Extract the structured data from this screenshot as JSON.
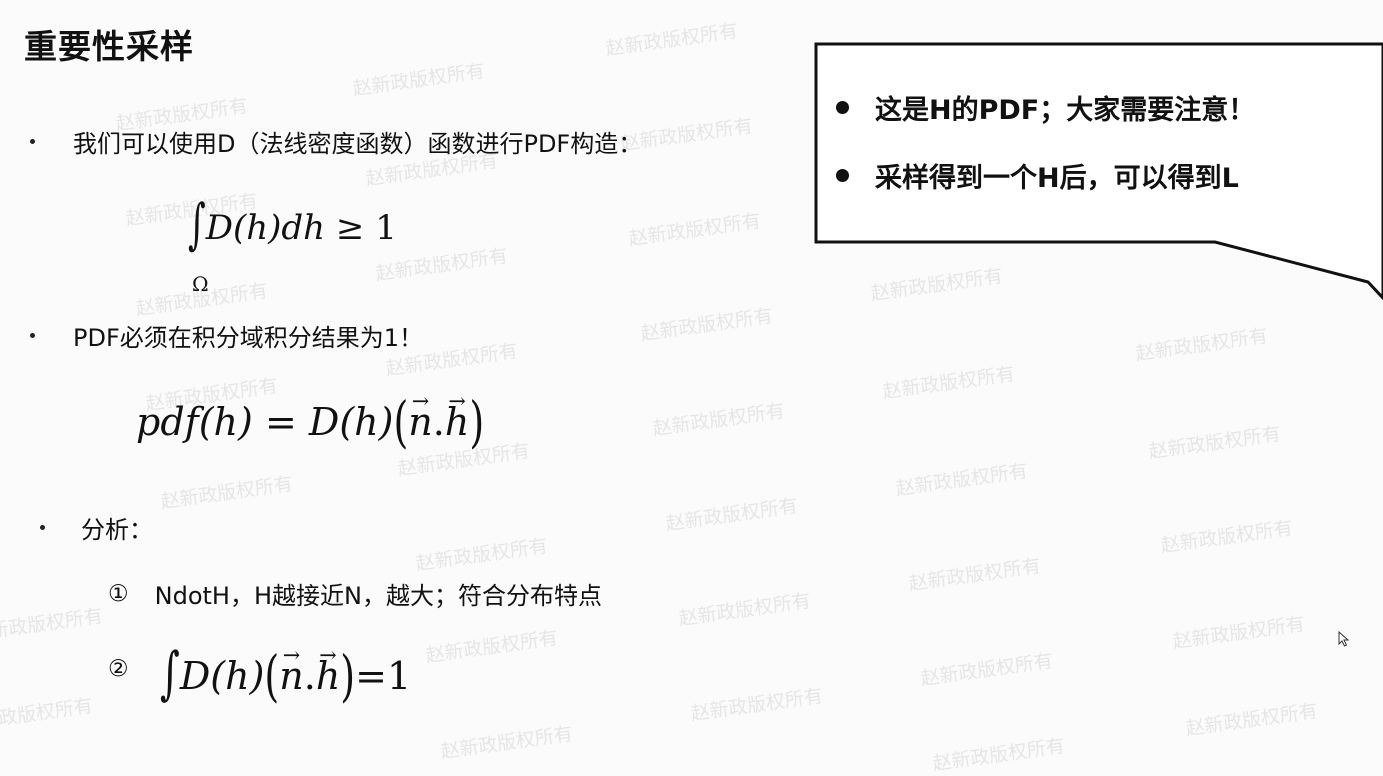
{
  "slide": {
    "title": "重要性采样",
    "bullets": [
      "我们可以使用D（法线密度函数）函数进行PDF构造：",
      "PDF必须在积分域积分结果为1！",
      "分析："
    ],
    "formula1": {
      "integral": "∫",
      "subscript": "Ω",
      "body": "D(h)dh",
      "relation": "≥",
      "rhs": "1"
    },
    "formula2": {
      "lhs": "pdf(h)",
      "eq": "=",
      "d": "D(h)",
      "n": "n",
      "dot": ".",
      "h": "h"
    },
    "analysis": [
      {
        "marker": "①",
        "text": "NdotH，H越接近N，越大；符合分布特点"
      },
      {
        "marker": "②",
        "integral": "∫",
        "d": "D(h)",
        "n": "n",
        "dot": ".",
        "h": "h",
        "eq": "=",
        "rhs": "1"
      }
    ]
  },
  "callout": {
    "items": [
      "这是H的PDF；大家需要注意！",
      "采样得到一个H后，可以得到L"
    ]
  },
  "watermark": "赵新政版权所有"
}
